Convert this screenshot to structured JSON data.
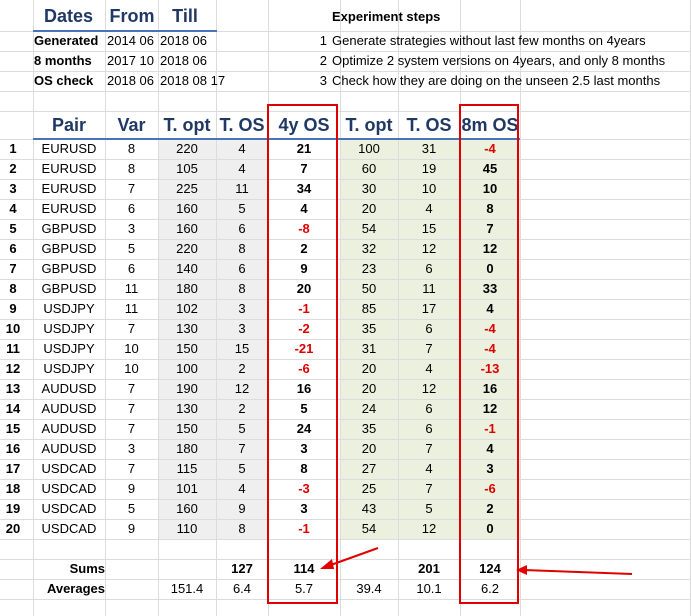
{
  "top_table": {
    "headers": {
      "dates": "Dates",
      "from": "From",
      "till": "Till"
    },
    "rows": [
      {
        "label": "Generated",
        "from": "2014 06",
        "till": "2018 06"
      },
      {
        "label": "8 months",
        "from": "2017 10",
        "till": "2018 06"
      },
      {
        "label": "OS check",
        "from": "2018 06",
        "till": "2018 08 17"
      }
    ]
  },
  "experiment": {
    "title": "Experiment steps",
    "steps": [
      {
        "num": "1",
        "text": "Generate strategies without last few months on 4years"
      },
      {
        "num": "2",
        "text": "Optimize 2 system versions on 4years, and only 8 months"
      },
      {
        "num": "3",
        "text": "Check how they are doing on the unseen 2.5 last months"
      }
    ]
  },
  "main_table": {
    "headers": {
      "pair": "Pair",
      "var": "Var",
      "t_opt_1": "T. opt",
      "t_os_1": "T. OS",
      "os_4y": "4y OS",
      "t_opt_2": "T. opt",
      "t_os_2": "T. OS",
      "os_8m": "8m OS"
    },
    "rows": [
      {
        "idx": "1",
        "pair": "EURUSD",
        "var": "8",
        "t_opt_1": "220",
        "t_os_1": "4",
        "os_4y": "21",
        "t_opt_2": "100",
        "t_os_2": "31",
        "os_8m": "-4"
      },
      {
        "idx": "2",
        "pair": "EURUSD",
        "var": "8",
        "t_opt_1": "105",
        "t_os_1": "4",
        "os_4y": "7",
        "t_opt_2": "60",
        "t_os_2": "19",
        "os_8m": "45"
      },
      {
        "idx": "3",
        "pair": "EURUSD",
        "var": "7",
        "t_opt_1": "225",
        "t_os_1": "11",
        "os_4y": "34",
        "t_opt_2": "30",
        "t_os_2": "10",
        "os_8m": "10"
      },
      {
        "idx": "4",
        "pair": "EURUSD",
        "var": "6",
        "t_opt_1": "160",
        "t_os_1": "5",
        "os_4y": "4",
        "t_opt_2": "20",
        "t_os_2": "4",
        "os_8m": "8"
      },
      {
        "idx": "5",
        "pair": "GBPUSD",
        "var": "3",
        "t_opt_1": "160",
        "t_os_1": "6",
        "os_4y": "-8",
        "t_opt_2": "54",
        "t_os_2": "15",
        "os_8m": "7"
      },
      {
        "idx": "6",
        "pair": "GBPUSD",
        "var": "5",
        "t_opt_1": "220",
        "t_os_1": "8",
        "os_4y": "2",
        "t_opt_2": "32",
        "t_os_2": "12",
        "os_8m": "12"
      },
      {
        "idx": "7",
        "pair": "GBPUSD",
        "var": "6",
        "t_opt_1": "140",
        "t_os_1": "6",
        "os_4y": "9",
        "t_opt_2": "23",
        "t_os_2": "6",
        "os_8m": "0"
      },
      {
        "idx": "8",
        "pair": "GBPUSD",
        "var": "11",
        "t_opt_1": "180",
        "t_os_1": "8",
        "os_4y": "20",
        "t_opt_2": "50",
        "t_os_2": "11",
        "os_8m": "33"
      },
      {
        "idx": "9",
        "pair": "USDJPY",
        "var": "11",
        "t_opt_1": "102",
        "t_os_1": "3",
        "os_4y": "-1",
        "t_opt_2": "85",
        "t_os_2": "17",
        "os_8m": "4"
      },
      {
        "idx": "10",
        "pair": "USDJPY",
        "var": "7",
        "t_opt_1": "130",
        "t_os_1": "3",
        "os_4y": "-2",
        "t_opt_2": "35",
        "t_os_2": "6",
        "os_8m": "-4"
      },
      {
        "idx": "11",
        "pair": "USDJPY",
        "var": "10",
        "t_opt_1": "150",
        "t_os_1": "15",
        "os_4y": "-21",
        "t_opt_2": "31",
        "t_os_2": "7",
        "os_8m": "-4"
      },
      {
        "idx": "12",
        "pair": "USDJPY",
        "var": "10",
        "t_opt_1": "100",
        "t_os_1": "2",
        "os_4y": "-6",
        "t_opt_2": "20",
        "t_os_2": "4",
        "os_8m": "-13"
      },
      {
        "idx": "13",
        "pair": "AUDUSD",
        "var": "7",
        "t_opt_1": "190",
        "t_os_1": "12",
        "os_4y": "16",
        "t_opt_2": "20",
        "t_os_2": "12",
        "os_8m": "16"
      },
      {
        "idx": "14",
        "pair": "AUDUSD",
        "var": "7",
        "t_opt_1": "130",
        "t_os_1": "2",
        "os_4y": "5",
        "t_opt_2": "24",
        "t_os_2": "6",
        "os_8m": "12"
      },
      {
        "idx": "15",
        "pair": "AUDUSD",
        "var": "7",
        "t_opt_1": "150",
        "t_os_1": "5",
        "os_4y": "24",
        "t_opt_2": "35",
        "t_os_2": "6",
        "os_8m": "-1"
      },
      {
        "idx": "16",
        "pair": "AUDUSD",
        "var": "3",
        "t_opt_1": "180",
        "t_os_1": "7",
        "os_4y": "3",
        "t_opt_2": "20",
        "t_os_2": "7",
        "os_8m": "4"
      },
      {
        "idx": "17",
        "pair": "USDCAD",
        "var": "7",
        "t_opt_1": "115",
        "t_os_1": "5",
        "os_4y": "8",
        "t_opt_2": "27",
        "t_os_2": "4",
        "os_8m": "3"
      },
      {
        "idx": "18",
        "pair": "USDCAD",
        "var": "9",
        "t_opt_1": "101",
        "t_os_1": "4",
        "os_4y": "-3",
        "t_opt_2": "25",
        "t_os_2": "7",
        "os_8m": "-6"
      },
      {
        "idx": "19",
        "pair": "USDCAD",
        "var": "5",
        "t_opt_1": "160",
        "t_os_1": "9",
        "os_4y": "3",
        "t_opt_2": "43",
        "t_os_2": "5",
        "os_8m": "2"
      },
      {
        "idx": "20",
        "pair": "USDCAD",
        "var": "9",
        "t_opt_1": "110",
        "t_os_1": "8",
        "os_4y": "-1",
        "t_opt_2": "54",
        "t_os_2": "12",
        "os_8m": "0"
      }
    ],
    "sums": {
      "label": "Sums",
      "t_os_1": "127",
      "os_4y": "114",
      "t_os_2": "201",
      "os_8m": "124"
    },
    "averages": {
      "label": "Averages",
      "t_opt_1": "151.4",
      "t_os_1": "6.4",
      "os_4y": "5.7",
      "t_opt_2": "39.4",
      "t_os_2": "10.1",
      "os_8m": "6.2"
    }
  },
  "colors": {
    "header_text": "#1f3864",
    "underline": "#4a73b8",
    "negative": "#e00000",
    "annotation_red": "#e00000",
    "shade_gray": "#efefef",
    "shade_green": "#ebf1de"
  }
}
